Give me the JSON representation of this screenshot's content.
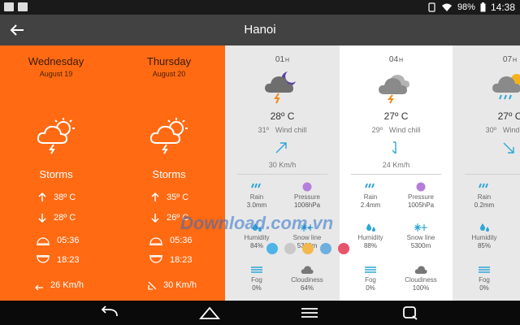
{
  "status_bar": {
    "battery": "98%",
    "time": "14:38"
  },
  "app_bar": {
    "title": "Hanoi",
    "back_icon": "arrow-left-icon"
  },
  "colors": {
    "daily_bg": "#ff6a13",
    "app_bar": "#424242",
    "accent_blue": "#2fa6d6",
    "pressure_purple": "#b57edc"
  },
  "daily": [
    {
      "day": "Wednesday",
      "date": "August 19",
      "condition": "Storms",
      "high": "38º C",
      "low": "28º C",
      "sunrise": "05:36",
      "sunset": "18:23",
      "wind": "26 Km/h"
    },
    {
      "day": "Thursday",
      "date": "August 20",
      "condition": "Storms",
      "high": "35º C",
      "low": "26º C",
      "sunrise": "05:36",
      "sunset": "18:23",
      "wind": "30 Km/h"
    }
  ],
  "hourly": [
    {
      "hour": "01",
      "suffix": "H",
      "temp": "28º C",
      "chill_temp": "31º",
      "chill_label": "Wind chill",
      "wind": "30 Km/h",
      "rain_label": "Rain",
      "rain": "3.0mm",
      "pressure_label": "Pressure",
      "pressure": "1006hPa",
      "humidity_label": "Humidity",
      "humidity": "84%",
      "snow_label": "Snow line",
      "snow": "5300m",
      "fog_label": "Fog",
      "fog": "0%",
      "cloud_label": "Cloudiness",
      "cloud": "64%"
    },
    {
      "hour": "04",
      "suffix": "H",
      "temp": "27º C",
      "chill_temp": "29º",
      "chill_label": "Wind chill",
      "wind": "24 Km/h",
      "rain_label": "Rain",
      "rain": "2.4mm",
      "pressure_label": "Pressure",
      "pressure": "1005hPa",
      "humidity_label": "Humidity",
      "humidity": "88%",
      "snow_label": "Snow line",
      "snow": "5300m",
      "fog_label": "Fog",
      "fog": "0%",
      "cloud_label": "Cloudiness",
      "cloud": "100%"
    },
    {
      "hour": "07",
      "suffix": "H",
      "temp": "27º C",
      "chill_temp": "30º",
      "chill_label": "Wind chill",
      "rain_label": "Rain",
      "rain": "0.2mm",
      "humidity_label": "Humidity",
      "humidity": "85%",
      "fog_label": "Fog",
      "fog": "0%"
    }
  ],
  "watermark": {
    "text": "Download.com.vn",
    "dot_colors": [
      "#4fb3e8",
      "#c9c9c9",
      "#f2b84b",
      "#6db0e0",
      "#e8546a"
    ]
  }
}
